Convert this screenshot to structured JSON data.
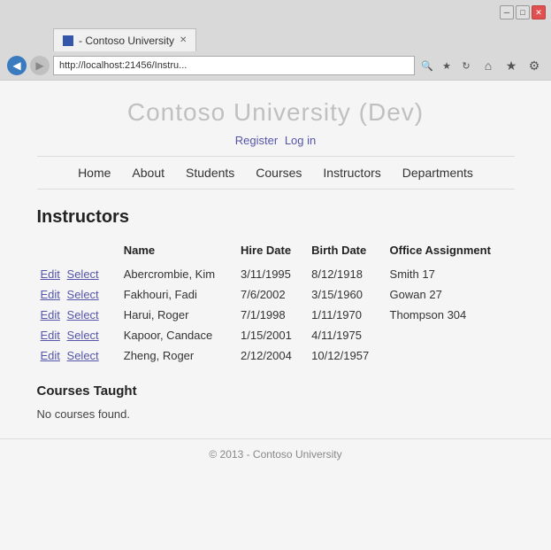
{
  "browser": {
    "title_bar": {
      "minimize_label": "─",
      "maximize_label": "□",
      "close_label": "✕"
    },
    "tab": {
      "label": "- Contoso University",
      "close_label": "✕"
    },
    "address": {
      "url": "http://localhost:21456/Instru...",
      "back_icon": "◀",
      "forward_icon": "▶",
      "refresh_icon": "↻",
      "search_icon": "🔍"
    },
    "toolbar": {
      "home_icon": "⌂",
      "star_icon": "★",
      "gear_icon": "⚙"
    }
  },
  "page": {
    "site_title": "Contoso University (Dev)",
    "nav_links": [
      {
        "label": "Register"
      },
      {
        "label": "Log in"
      }
    ],
    "nav_items": [
      {
        "label": "Home"
      },
      {
        "label": "About"
      },
      {
        "label": "Students"
      },
      {
        "label": "Courses"
      },
      {
        "label": "Instructors"
      },
      {
        "label": "Departments"
      }
    ],
    "instructors_section": {
      "title": "Instructors",
      "table_headers": {
        "name": "Name",
        "hire_date": "Hire Date",
        "birth_date": "Birth Date",
        "office_assignment": "Office Assignment"
      },
      "rows": [
        {
          "name": "Abercrombie, Kim",
          "hire_date": "3/11/1995",
          "birth_date": "8/12/1918",
          "office": "Smith 17"
        },
        {
          "name": "Fakhouri, Fadi",
          "hire_date": "7/6/2002",
          "birth_date": "3/15/1960",
          "office": "Gowan 27"
        },
        {
          "name": "Harui, Roger",
          "hire_date": "7/1/1998",
          "birth_date": "1/11/1970",
          "office": "Thompson 304"
        },
        {
          "name": "Kapoor, Candace",
          "hire_date": "1/15/2001",
          "birth_date": "4/11/1975",
          "office": ""
        },
        {
          "name": "Zheng, Roger",
          "hire_date": "2/12/2004",
          "birth_date": "10/12/1957",
          "office": ""
        }
      ],
      "edit_label": "Edit",
      "select_label": "Select"
    },
    "courses_section": {
      "title": "Courses Taught",
      "no_data": "No courses found."
    },
    "footer": {
      "text": "© 2013 - Contoso University"
    }
  }
}
